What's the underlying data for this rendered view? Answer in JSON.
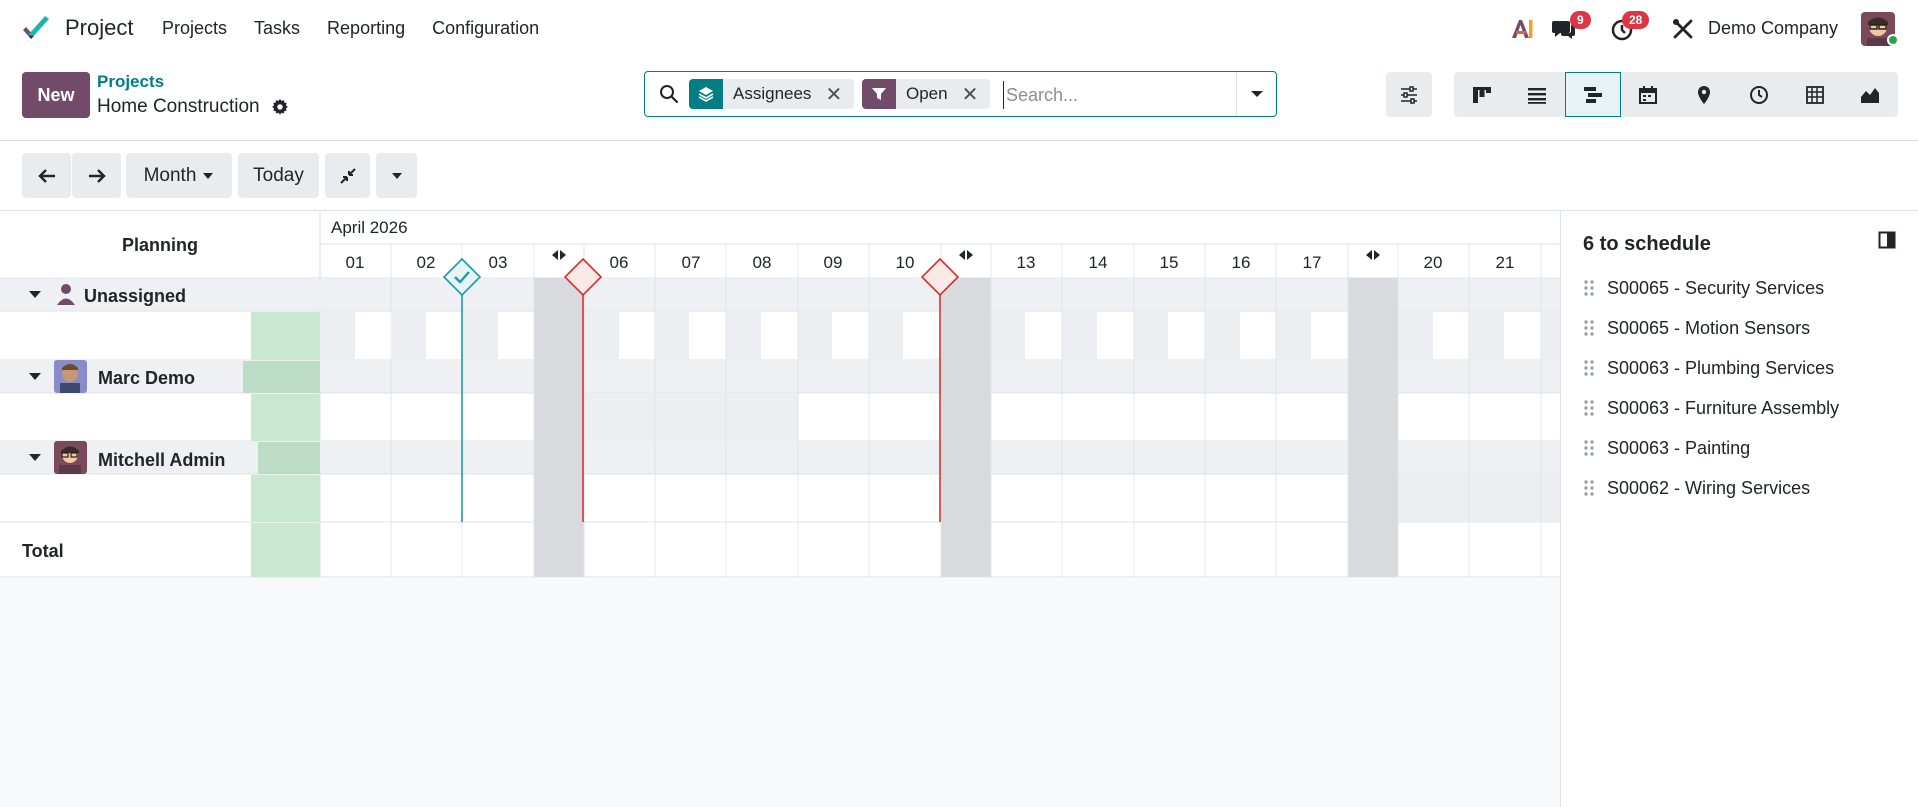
{
  "app": {
    "name": "Project",
    "menu": [
      "Projects",
      "Tasks",
      "Reporting",
      "Configuration"
    ],
    "company": "Demo Company",
    "messages_count": "9",
    "activities_count": "28"
  },
  "control_panel": {
    "new_label": "New",
    "breadcrumb_parent": "Projects",
    "breadcrumb_current": "Home Construction",
    "search": {
      "facets": [
        {
          "label": "Assignees",
          "icon": "layers-icon",
          "color": "#017e84"
        },
        {
          "label": "Open",
          "icon": "filter-icon",
          "color": "#714b67"
        }
      ],
      "placeholder": "Search..."
    },
    "views": [
      "kanban",
      "list",
      "gantt",
      "calendar",
      "map",
      "activity",
      "pivot",
      "graph"
    ],
    "active_view": "gantt"
  },
  "gantt_toolbar": {
    "scale_label": "Month",
    "today_label": "Today"
  },
  "gantt": {
    "header_title": "Planning",
    "month_label": "April 2026",
    "day_labels": [
      "01",
      "02",
      "03",
      "",
      "06",
      "07",
      "08",
      "09",
      "10",
      "",
      "13",
      "14",
      "15",
      "16",
      "17",
      "",
      "20",
      "21"
    ],
    "rows": [
      {
        "label": "Unassigned",
        "avatar": "person-icon"
      },
      {
        "label": "Marc Demo",
        "avatar": "marc-avatar"
      },
      {
        "label": "Mitchell Admin",
        "avatar": "mitchell-avatar"
      }
    ],
    "total_label": "Total"
  },
  "side_panel": {
    "title": "6 to schedule",
    "items": [
      "S00065 - Security Services",
      "S00065 - Motion Sensors",
      "S00063 - Plumbing Services",
      "S00063 - Furniture Assembly",
      "S00063 - Painting",
      "S00062 - Wiring Services"
    ]
  },
  "colors": {
    "brand": "#714b67",
    "accent": "#017e84",
    "danger": "#dc3545"
  }
}
